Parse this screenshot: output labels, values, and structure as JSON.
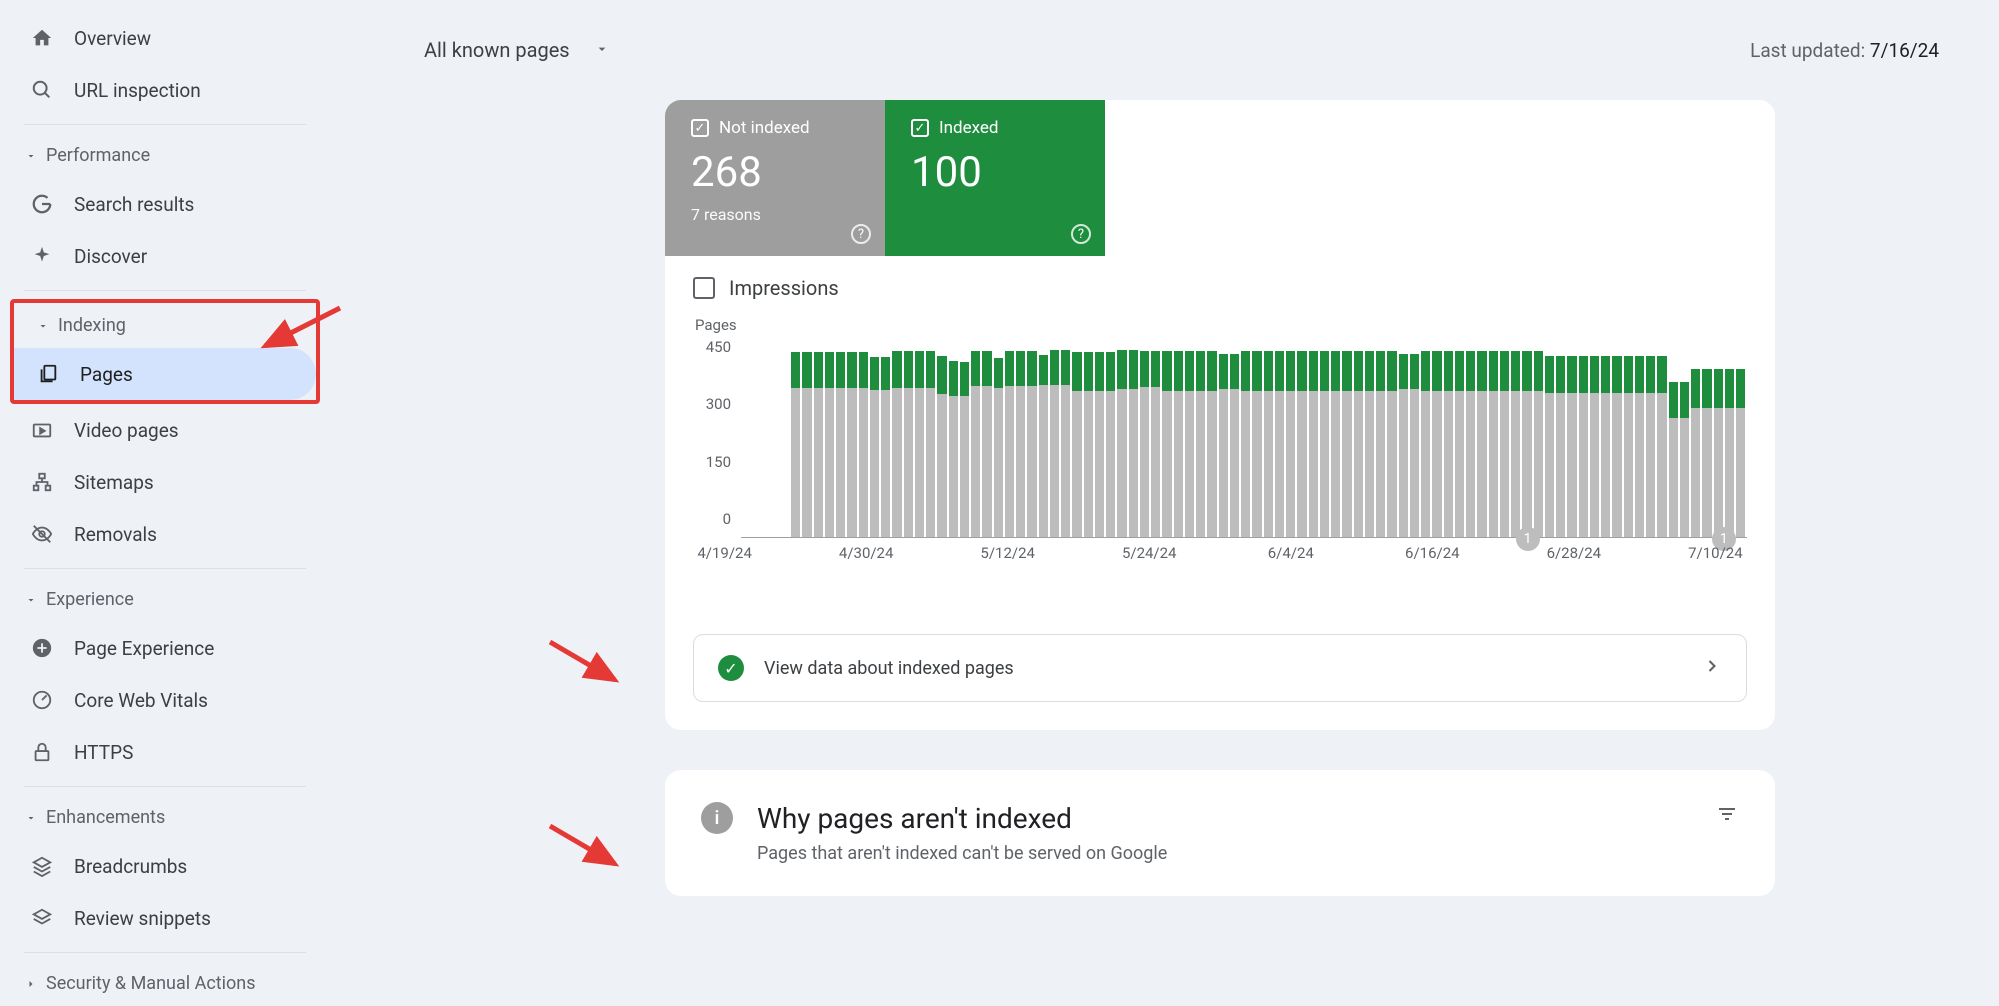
{
  "sidebar": {
    "overview": "Overview",
    "url_inspection": "URL inspection",
    "performance_group": "Performance",
    "search_results": "Search results",
    "discover": "Discover",
    "indexing_group": "Indexing",
    "pages": "Pages",
    "video_pages": "Video pages",
    "sitemaps": "Sitemaps",
    "removals": "Removals",
    "experience_group": "Experience",
    "page_experience": "Page Experience",
    "core_web_vitals": "Core Web Vitals",
    "https": "HTTPS",
    "enhancements_group": "Enhancements",
    "breadcrumbs": "Breadcrumbs",
    "review_snippets": "Review snippets",
    "security_group": "Security & Manual Actions"
  },
  "topbar": {
    "dropdown": "All known pages",
    "last_updated_label": "Last updated: ",
    "last_updated_date": "7/16/24"
  },
  "stats": {
    "not_indexed_label": "Not indexed",
    "not_indexed_value": "268",
    "not_indexed_sub": "7 reasons",
    "indexed_label": "Indexed",
    "indexed_value": "100"
  },
  "impressions_label": "Impressions",
  "chart_data": {
    "type": "bar",
    "ylabel": "Pages",
    "y_ticks": [
      "450",
      "300",
      "150",
      "0"
    ],
    "ylim": [
      0,
      450
    ],
    "x_ticks": [
      "4/19/24",
      "4/30/24",
      "5/12/24",
      "5/24/24",
      "6/4/24",
      "6/16/24",
      "6/28/24",
      "7/10/24"
    ],
    "badges": [
      {
        "pos_pct": 77,
        "label": "1"
      },
      {
        "pos_pct": 96.5,
        "label": "1"
      }
    ],
    "series": [
      {
        "name": "Indexed",
        "color": "#1e8e3e"
      },
      {
        "name": "Not indexed",
        "color": "#bdbdbd"
      }
    ],
    "bars": [
      {
        "indexed": 80,
        "not": 338
      },
      {
        "indexed": 80,
        "not": 338
      },
      {
        "indexed": 80,
        "not": 338
      },
      {
        "indexed": 80,
        "not": 338
      },
      {
        "indexed": 80,
        "not": 338
      },
      {
        "indexed": 80,
        "not": 338
      },
      {
        "indexed": 80,
        "not": 338
      },
      {
        "indexed": 76,
        "not": 332
      },
      {
        "indexed": 76,
        "not": 332
      },
      {
        "indexed": 82,
        "not": 338
      },
      {
        "indexed": 82,
        "not": 338
      },
      {
        "indexed": 82,
        "not": 338
      },
      {
        "indexed": 82,
        "not": 338
      },
      {
        "indexed": 86,
        "not": 324
      },
      {
        "indexed": 80,
        "not": 318
      },
      {
        "indexed": 78,
        "not": 318
      },
      {
        "indexed": 78,
        "not": 342
      },
      {
        "indexed": 78,
        "not": 342
      },
      {
        "indexed": 68,
        "not": 336
      },
      {
        "indexed": 78,
        "not": 342
      },
      {
        "indexed": 78,
        "not": 342
      },
      {
        "indexed": 78,
        "not": 342
      },
      {
        "indexed": 68,
        "not": 344
      },
      {
        "indexed": 80,
        "not": 344
      },
      {
        "indexed": 80,
        "not": 344
      },
      {
        "indexed": 88,
        "not": 330
      },
      {
        "indexed": 88,
        "not": 330
      },
      {
        "indexed": 88,
        "not": 330
      },
      {
        "indexed": 88,
        "not": 330
      },
      {
        "indexed": 90,
        "not": 334
      },
      {
        "indexed": 90,
        "not": 334
      },
      {
        "indexed": 80,
        "not": 340
      },
      {
        "indexed": 80,
        "not": 340
      },
      {
        "indexed": 90,
        "not": 330
      },
      {
        "indexed": 90,
        "not": 330
      },
      {
        "indexed": 90,
        "not": 330
      },
      {
        "indexed": 90,
        "not": 330
      },
      {
        "indexed": 90,
        "not": 330
      },
      {
        "indexed": 80,
        "not": 334
      },
      {
        "indexed": 80,
        "not": 334
      },
      {
        "indexed": 90,
        "not": 330
      },
      {
        "indexed": 90,
        "not": 330
      },
      {
        "indexed": 90,
        "not": 330
      },
      {
        "indexed": 90,
        "not": 330
      },
      {
        "indexed": 90,
        "not": 330
      },
      {
        "indexed": 90,
        "not": 330
      },
      {
        "indexed": 90,
        "not": 330
      },
      {
        "indexed": 90,
        "not": 330
      },
      {
        "indexed": 90,
        "not": 330
      },
      {
        "indexed": 90,
        "not": 330
      },
      {
        "indexed": 90,
        "not": 330
      },
      {
        "indexed": 90,
        "not": 330
      },
      {
        "indexed": 90,
        "not": 330
      },
      {
        "indexed": 90,
        "not": 330
      },
      {
        "indexed": 80,
        "not": 334
      },
      {
        "indexed": 80,
        "not": 334
      },
      {
        "indexed": 90,
        "not": 330
      },
      {
        "indexed": 90,
        "not": 330
      },
      {
        "indexed": 90,
        "not": 330
      },
      {
        "indexed": 90,
        "not": 330
      },
      {
        "indexed": 90,
        "not": 330
      },
      {
        "indexed": 90,
        "not": 330
      },
      {
        "indexed": 90,
        "not": 330
      },
      {
        "indexed": 90,
        "not": 330
      },
      {
        "indexed": 90,
        "not": 330
      },
      {
        "indexed": 90,
        "not": 330
      },
      {
        "indexed": 90,
        "not": 330
      },
      {
        "indexed": 84,
        "not": 326
      },
      {
        "indexed": 84,
        "not": 326
      },
      {
        "indexed": 84,
        "not": 326
      },
      {
        "indexed": 84,
        "not": 326
      },
      {
        "indexed": 84,
        "not": 326
      },
      {
        "indexed": 84,
        "not": 326
      },
      {
        "indexed": 84,
        "not": 326
      },
      {
        "indexed": 84,
        "not": 326
      },
      {
        "indexed": 84,
        "not": 326
      },
      {
        "indexed": 84,
        "not": 326
      },
      {
        "indexed": 84,
        "not": 326
      },
      {
        "indexed": 80,
        "not": 270
      },
      {
        "indexed": 80,
        "not": 270
      },
      {
        "indexed": 88,
        "not": 292
      },
      {
        "indexed": 88,
        "not": 292
      },
      {
        "indexed": 88,
        "not": 292
      },
      {
        "indexed": 88,
        "not": 292
      },
      {
        "indexed": 88,
        "not": 292
      }
    ]
  },
  "view_row": "View data about indexed pages",
  "card2": {
    "title": "Why pages aren't indexed",
    "subtitle": "Pages that aren't indexed can't be served on Google"
  }
}
